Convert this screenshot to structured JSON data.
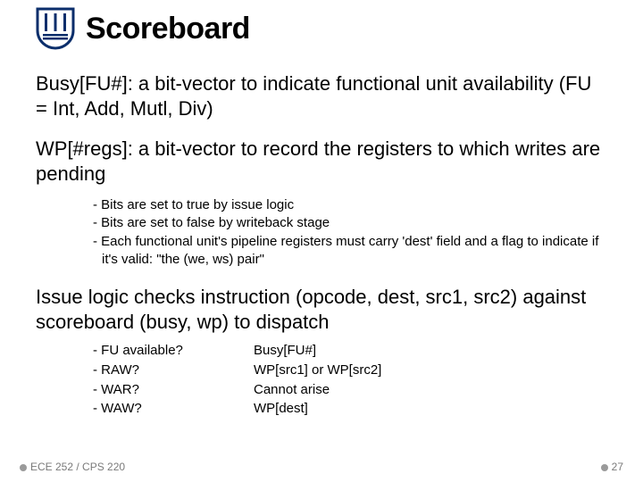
{
  "title": "Scoreboard",
  "paragraphs": {
    "busy": "Busy[FU#]: a bit-vector to indicate functional unit availability (FU = Int, Add, Mutl, Div)",
    "wp": "WP[#regs]:  a bit-vector to record the registers to which writes are pending",
    "issue": "Issue logic checks instruction (opcode, dest, src1, src2) against scoreboard (busy, wp) to dispatch"
  },
  "wp_notes": [
    "Bits are set to true by issue logic",
    "Bits are set to false by writeback stage",
    "Each functional unit's pipeline registers must carry 'dest' field and a flag to indicate if it's valid: \"the (we, ws) pair\""
  ],
  "checks": [
    {
      "q": "FU available?",
      "a": "Busy[FU#]"
    },
    {
      "q": "RAW?",
      "a": "WP[src1] or WP[src2]"
    },
    {
      "q": "WAR?",
      "a": "Cannot arise"
    },
    {
      "q": "WAW?",
      "a": "WP[dest]"
    }
  ],
  "footer": {
    "left": "ECE 252 / CPS 220",
    "right": "27"
  }
}
